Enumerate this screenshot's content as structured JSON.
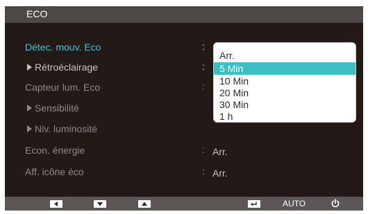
{
  "title": "ECO",
  "menu": {
    "items": [
      {
        "label": "Détec. mouv. Eco",
        "colon": ":",
        "value": ""
      },
      {
        "label": "Rétroéclairage",
        "colon": ":",
        "value": ""
      },
      {
        "label": "Capteur lum. Eco",
        "colon": ":",
        "value": ""
      },
      {
        "label": "Sensibilité",
        "colon": "",
        "value": ""
      },
      {
        "label": "Niv. luminosité",
        "colon": "",
        "value": ""
      },
      {
        "label": "Econ. énergie",
        "colon": ":",
        "value": "Arr."
      },
      {
        "label": "Aff. icône éco",
        "colon": ":",
        "value": "Arr."
      }
    ]
  },
  "dropdown": {
    "selected": "5 Min",
    "options": [
      "Arr.",
      "5 Min",
      "10 Min",
      "20 Min",
      "30 Min",
      "1 h"
    ]
  },
  "bottombar": {
    "left_icon": "left-arrow-icon",
    "down_icon": "down-arrow-icon",
    "up_icon": "up-arrow-icon",
    "enter_icon": "enter-icon",
    "auto_label": "AUTO",
    "power_icon": "power-icon"
  },
  "colors": {
    "background": "#231a18",
    "title_bar": "#4d4848",
    "accent": "#3cc8d6",
    "selection": "#3cbfc4",
    "bottom_bar": "#5c5655"
  }
}
